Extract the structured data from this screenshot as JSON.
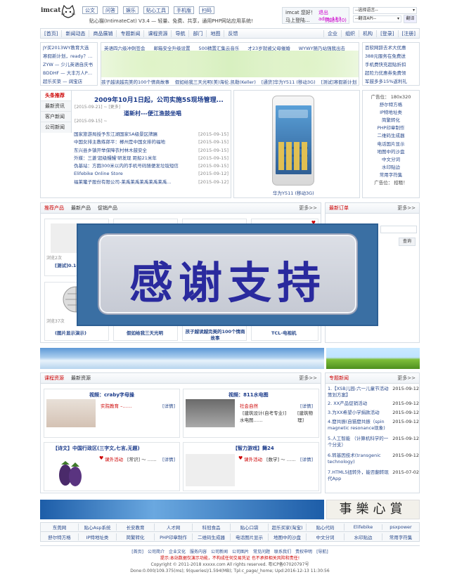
{
  "header": {
    "logo": "imcat",
    "tabs": [
      "公文",
      "问答",
      "娱乐",
      "贴心工具",
      "手机版",
      "扫码"
    ],
    "tagline": "贴心猫(IntimateCat) V3.4 — 轻量、免费、共享，通用PHP网站应用系统!",
    "greeting": "imcat 您好！",
    "user_link": "退出 adm_123",
    "quick_login": "马上登陆...",
    "cart": "购物车(0)",
    "lang_select": "--选择语言--",
    "api_select": "--翻译API--",
    "translate_btn": "翻译"
  },
  "nav": {
    "left": [
      "[首页]",
      "新闻动态",
      "商品展销",
      "专题新闻",
      "课程资源",
      "导航",
      "部门",
      "地图",
      "反馈"
    ],
    "right": [
      "企业",
      "组织",
      "机构",
      "[登录]",
      "[注册]"
    ]
  },
  "links": {
    "left": [
      "JY买2013WY教育大选",
      "寒假新计划，ready？GO",
      "ZYW — 少儿英语自庆书",
      "BDDHF — 大丰万人PE观",
      "超乐买菜 — 阔宝店"
    ],
    "top": [
      "英语四六级冲刺签会",
      "邮箱安全升级设置",
      "500精置汇集云音乐",
      "才23岁就被父母催婚",
      "WYWY随乃站强我出击"
    ],
    "bottom": [
      "孩子越读越完美的100个情商故事",
      "假如给我三天光明(美)海伦.凯勒(Keller)",
      "[通货]华为Y511 (移动3G)",
      "[测试]寒假新计划"
    ],
    "right": [
      "百软网辞去术大优惠",
      "388元服务在免费送",
      "手机费快充超贴折扣",
      "超险力优惠券免费领",
      "军鼓多多15%返利礼"
    ]
  },
  "news": {
    "tabs": [
      "头条推荐",
      "最新资讯",
      "客户新闻",
      "公司新闻"
    ],
    "headline": "2009年10月1日起，公司实施5S现场管理...",
    "headline_meta": "[2015-09-21] ~ [更多]",
    "subhead": "道新村---便江渔鼓坐唱",
    "subhead_meta": "[2015-09-15] ~",
    "items": [
      {
        "title": "国家旅游局授予东江湖国家5A级景区牌匾",
        "date": "[2015-09-15]"
      },
      {
        "title": "中国女排主教练郎平：郴州是中国女排的福地",
        "date": "[2015-09-15]"
      },
      {
        "title": "东兴县乡镇开举保障衣村林木鼓安全",
        "date": "[2015-09-15]"
      },
      {
        "title": "外媒：三菱'超级鳗鳗'研发现 距船21米年",
        "date": "[2015-09-15]"
      },
      {
        "title": "伪基站：方圆300米以内的手机号码随便发垃圾短信",
        "date": "[2015-09-15]"
      },
      {
        "title": "Elifebike Online Store",
        "date": "[2015-09-12]"
      },
      {
        "title": "福莱竃子股份有限公司-莱禹莱禹莱禹莱禹莱禹...",
        "date": "[2015-09-12]"
      }
    ]
  },
  "phone": {
    "caption": "华为Y511 (移动3G)"
  },
  "ads": {
    "title": "广告位： 180x320",
    "items": [
      "舒尔特方格",
      "IP特地址类",
      "简繁转化",
      "PHP印章制作",
      "二维码生成器",
      "电话国片显示",
      "地图中的沙盘",
      "中文分词",
      "水印贴边",
      "常用字符集"
    ],
    "footer": "广告位：  招租！"
  },
  "products": {
    "tabs": [
      "推荐产品",
      "最新产品",
      "促销产品"
    ],
    "more": "更多>>",
    "items": [
      {
        "hits": "浏览2次",
        "name": "[测试]0.10E"
      },
      {
        "hits": "",
        "name": ""
      },
      {
        "hits": "",
        "name": ""
      },
      {
        "hits": "",
        "name": ""
      },
      {
        "hits": "浏览37次",
        "name": "(图片显示演示)"
      },
      {
        "hits": "",
        "name": "假如给我三天光明"
      },
      {
        "hits": "",
        "name": "孩子越读越完美的100个情商故事"
      },
      {
        "hits": "",
        "name": "TCL-电视机"
      }
    ]
  },
  "orders": {
    "title": "最新订单",
    "more": "更多>>",
    "search_btn": "查询"
  },
  "overlay": {
    "text": "感谢支持"
  },
  "courses": {
    "tabs": [
      "课程资源",
      "最新资源"
    ],
    "more": "更多>>",
    "items": [
      {
        "title": "视频：craby字母操",
        "cat": "实院教育 –……",
        "more": "[详情]"
      },
      {
        "title": "视频：811水电图",
        "cat": "社会自然",
        "extra": "[建筑设计(自考专业)]",
        "more": "[详情]",
        "extra2": "[建筑物理]",
        "extra3": "水电图……"
      },
      {
        "title": "【诗文】中国行政区(三字文,七言,无题)",
        "cat": "课外活动",
        "extra": "[常识] ～ ……",
        "more": "[详情]"
      },
      {
        "title": "【智力游戏】舞24",
        "cat": "课外活动",
        "extra": "[数学] ～ ……",
        "more": "[详情]"
      }
    ]
  },
  "topics": {
    "title": "专题新闻",
    "more": "更多>>",
    "items": [
      {
        "title": "1.【XSB儿园-六一儿童节活动策划方案】",
        "date": "2015-09-12"
      },
      {
        "title": "2. XX产品促销活动",
        "date": "2015-09-12"
      },
      {
        "title": "3.为XX希望小学捐款活动",
        "date": "2015-09-12"
      },
      {
        "title": "4.窟共振(自猫窟共振（spin magnetic resonance现象)",
        "date": "2015-09-12"
      },
      {
        "title": "5.人工智能 （计算机科学的一个分支）",
        "date": "2015-09-12"
      },
      {
        "title": "6.转基因技术(transgenic technology)",
        "date": "2015-09-12"
      },
      {
        "title": "7.HTML5扭转外，能否翻转现代App",
        "date": "2015-07-02"
      }
    ]
  },
  "banner": {
    "calligraphy": "賞心樂事"
  },
  "friends": {
    "row1": [
      "东莞网",
      "贴心Asp系统",
      "长安教育",
      "人才网",
      "科冠食品",
      "贴心口袋",
      "超乐买家(淘宝)",
      "贴心代码",
      "Elifebike",
      "psxpower"
    ],
    "row2": [
      "舒尔特方格",
      "IP特地址类",
      "简繁转化",
      "PHP印章制作",
      "二维码生成器",
      "电话图片显示",
      "地图中的沙盘",
      "中文分词",
      "水印贴边",
      "常用字符集"
    ]
  },
  "footer": {
    "links": [
      "[首页]",
      "公司简介",
      "企业文化",
      "服务内容",
      "公司新闻",
      "公司图片",
      "常见问题",
      "联系我们",
      "责权申明",
      "[导航]"
    ],
    "notice": "提示:本站数据仅演示功能，不构成任何交易凭证 也不承担相关风险和责任!",
    "copyright": "Copyright © 2011-2018 xxxxx.com All rights reserved. 粤ICP备07020797号",
    "stats": "Done:0.000/109.375(ms); 9(queries)/1.594(MB); Tpl:c_page/_home; Upd:2016-12-13 11:30:56"
  }
}
